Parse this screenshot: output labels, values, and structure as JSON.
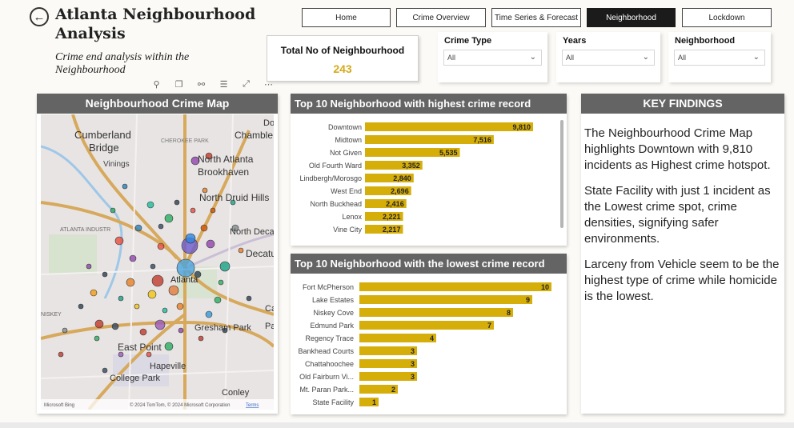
{
  "header": {
    "title": "Atlanta Neighbourhood Analysis",
    "subtitle": "Crime end analysis within the Neighbourhood"
  },
  "nav": {
    "items": [
      {
        "label": "Home",
        "active": false
      },
      {
        "label": "Crime Overview",
        "active": false
      },
      {
        "label": "Time Series & Forecast",
        "active": false
      },
      {
        "label": "Neighborhood",
        "active": true
      },
      {
        "label": "Lockdown",
        "active": false
      }
    ]
  },
  "kpi": {
    "label": "Total No of Neighbourhood",
    "value": "243"
  },
  "slicers": [
    {
      "label": "Crime Type",
      "value": "All"
    },
    {
      "label": "Years",
      "value": "All"
    },
    {
      "label": "Neighborhood",
      "value": "All"
    }
  ],
  "toolbar": {
    "icons": [
      "pin-icon",
      "copy-icon",
      "bell-icon",
      "filter-icon",
      "focus-mode-icon",
      "more-options-icon"
    ]
  },
  "map": {
    "title": "Neighbourhood Crime Map",
    "places": [
      "Cumberland",
      "Bridge",
      "Vinings",
      "CHEROKEE PARK",
      "North Atlanta",
      "Brookhaven",
      "Chamble",
      "North Druid Hills",
      "North Decat",
      "Decatu",
      "ATLANTA INDUSTR",
      "Atlanta",
      "NISKEY",
      "Gresham Park",
      "East Point",
      "Hapeville",
      "College Park",
      "Conley",
      "Do",
      "Ca",
      "Pa"
    ],
    "footer_left": "Microsoft Bing",
    "footer_right": "© 2024 TomTom, © 2024 Microsoft Corporation",
    "terms": "Terms"
  },
  "chart_data": [
    {
      "type": "bar",
      "title": "Top 10 Neighborhood with highest crime record",
      "categories": [
        "Downtown",
        "Midtown",
        "Not Given",
        "Old Fourth Ward",
        "Lindbergh/Morosgo",
        "West End",
        "North Buckhead",
        "Lenox",
        "Vine City"
      ],
      "values": [
        9810,
        7516,
        5535,
        3352,
        2840,
        2696,
        2416,
        2221,
        2217
      ],
      "labels": [
        "9,810",
        "7,516",
        "5,535",
        "3,352",
        "2,840",
        "2,696",
        "2,416",
        "2,221",
        "2,217"
      ],
      "color": "#d6ae0a"
    },
    {
      "type": "bar",
      "title": "Top 10 Neighborhood with the lowest crime record",
      "categories": [
        "Fort McPherson",
        "Lake Estates",
        "Niskey Cove",
        "Edmund Park",
        "Regency Trace",
        "Bankhead Courts",
        "Chattahoochee",
        "Old Fairburn Vi...",
        "Mt. Paran Park...",
        "State Facility"
      ],
      "values": [
        10,
        9,
        8,
        7,
        4,
        3,
        3,
        3,
        2,
        1
      ],
      "labels": [
        "10",
        "9",
        "8",
        "7",
        "4",
        "3",
        "3",
        "3",
        "2",
        "1"
      ],
      "color": "#d6ae0a"
    }
  ],
  "key_findings": {
    "title": "KEY FINDINGS",
    "paragraphs": [
      "The Neighbourhood Crime Map highlights Downtown with 9,810 incidents as Highest crime hotspot.",
      "State Facility with just 1 incident as the Lowest crime spot, crime densities, signifying safer environments.",
      "Larceny from Vehicle seem to be the highest type of crime while homicide is the lowest."
    ]
  }
}
